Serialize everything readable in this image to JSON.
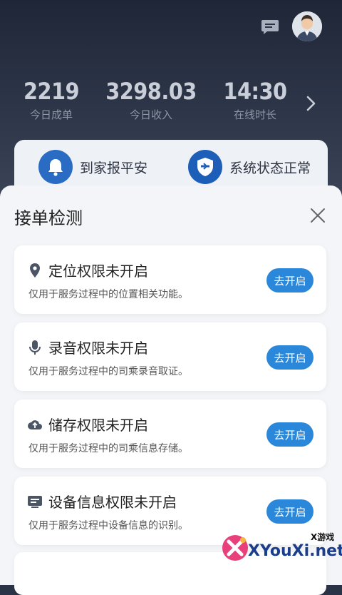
{
  "header": {
    "stats": [
      {
        "value": "2219",
        "label": "今日成单"
      },
      {
        "value": "3298.03",
        "label": "今日收入"
      },
      {
        "value": "14:30",
        "label": "在线时长"
      }
    ],
    "banner": {
      "left": "到家报平安",
      "right": "系统状态正常"
    },
    "icons": {
      "message": "message-icon",
      "avatar": "avatar",
      "more": "chevron-right-icon"
    }
  },
  "sheet": {
    "title": "接单检测",
    "items": [
      {
        "title": "定位权限未开启",
        "desc": "仅用于服务过程中的位置相关功能。",
        "button": "去开启",
        "icon": "location-icon"
      },
      {
        "title": "录音权限未开启",
        "desc": "仅用于服务过程中的司乘录音取证。",
        "button": "去开启",
        "icon": "microphone-icon"
      },
      {
        "title": "储存权限未开启",
        "desc": "仅用于服务过程中的司乘信息存储。",
        "button": "去开启",
        "icon": "cloud-upload-icon"
      },
      {
        "title": "设备信息权限未开启",
        "desc": "仅用于服务过程中设备信息的识别。",
        "button": "去开启",
        "icon": "device-info-icon"
      }
    ]
  },
  "watermark": {
    "cn": "X游戏",
    "en": "XYouXi.net"
  },
  "colors": {
    "accent": "#2a87d9",
    "header_bg": "#1f2638",
    "sheet_bg": "#f4f5f8"
  }
}
